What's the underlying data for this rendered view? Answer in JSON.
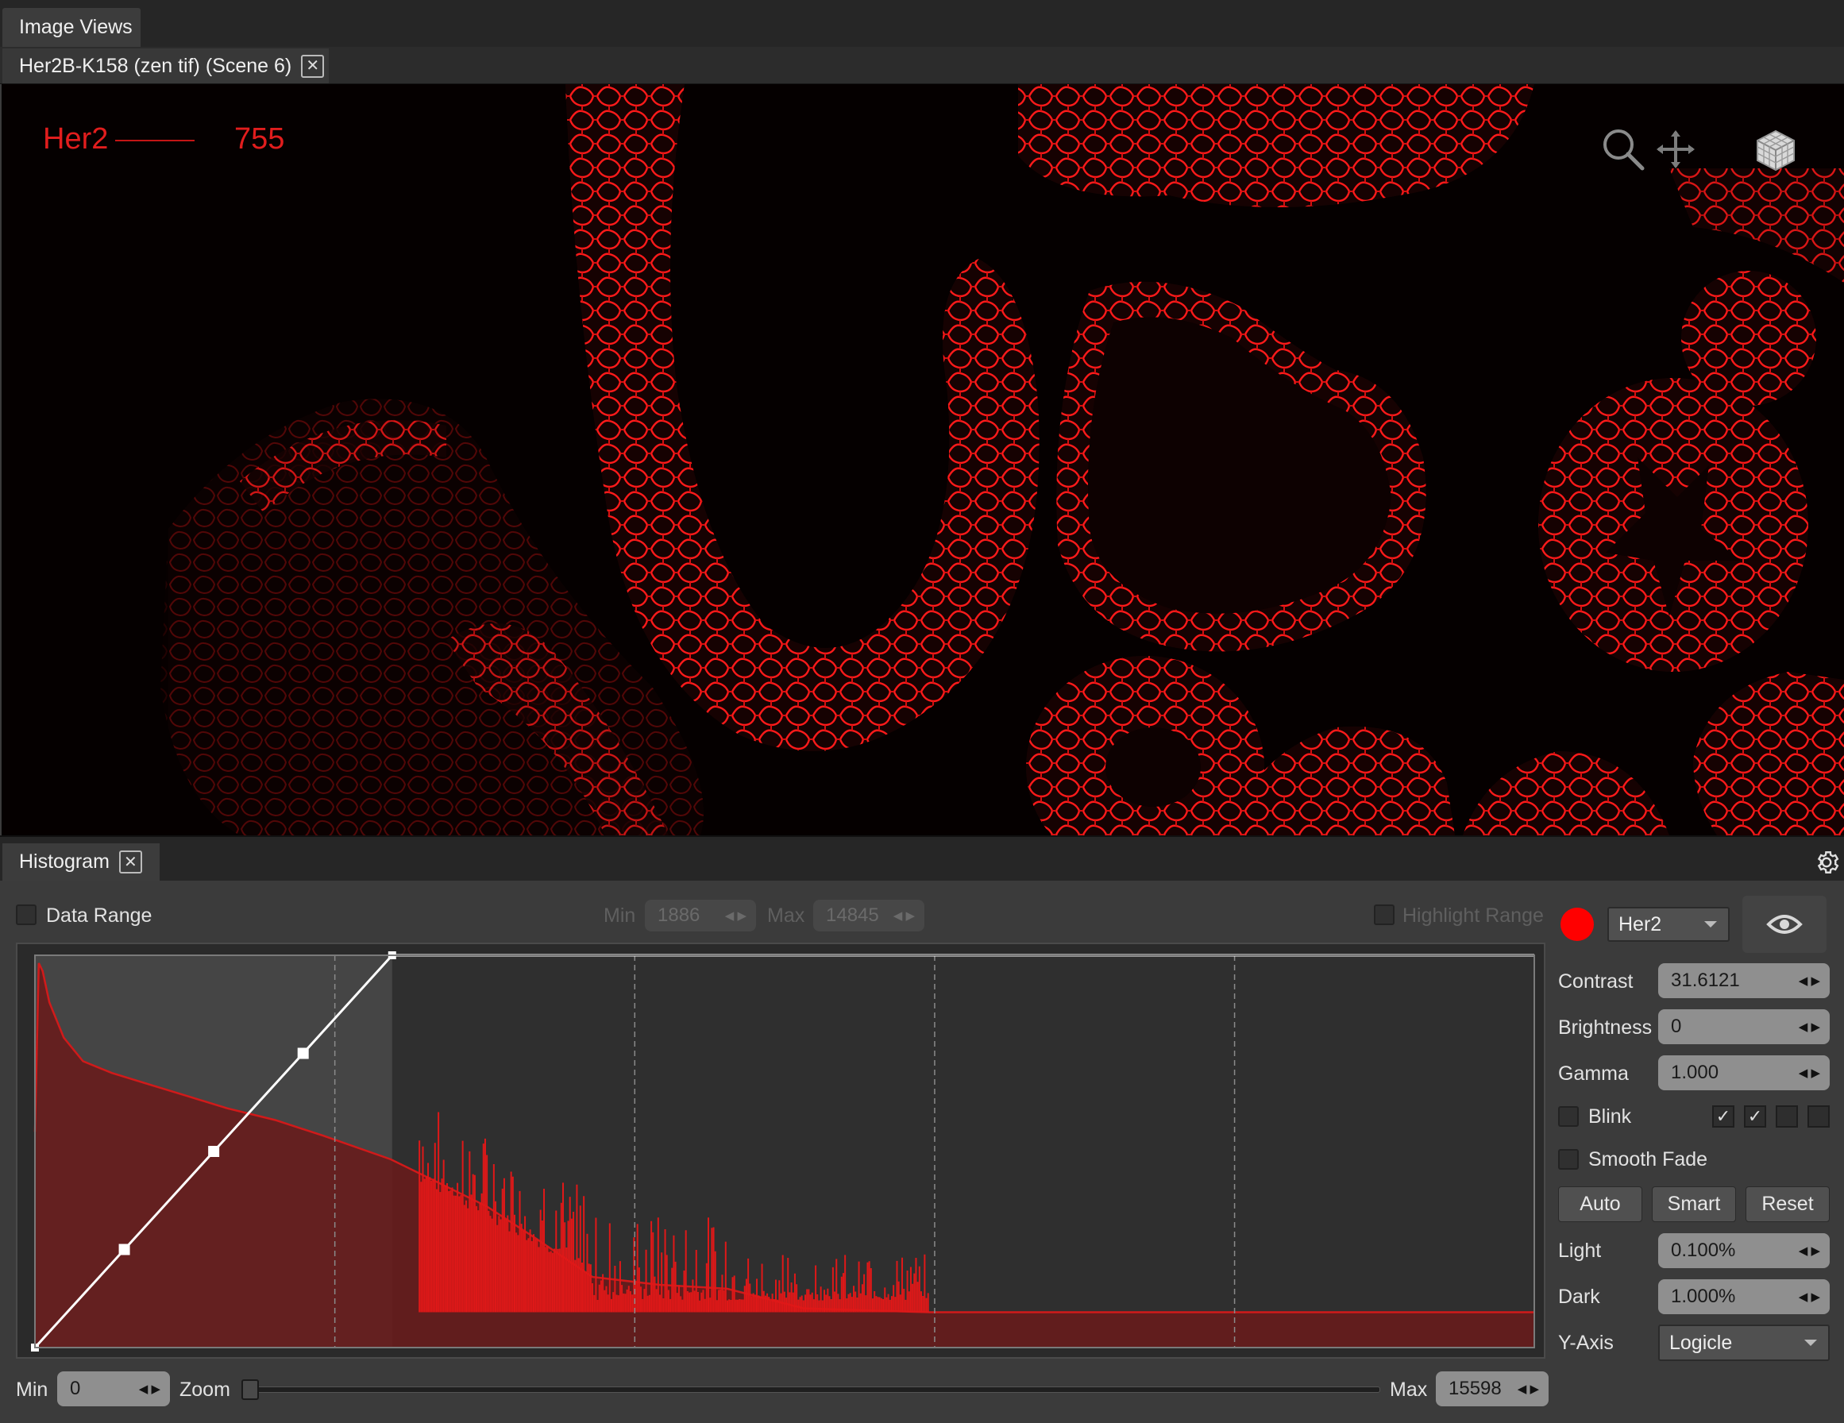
{
  "window": {
    "panel_tab": "Image Views",
    "document_tab": "Her2B-K158 (zen tif) (Scene 6)"
  },
  "viewer": {
    "channel_name": "Her2",
    "channel_value": "755",
    "channel_color": "#e11d1d",
    "tools": [
      "zoom-icon",
      "pan-icon",
      "3d-cube-icon"
    ]
  },
  "histogram": {
    "tab_label": "Histogram",
    "data_range_label": "Data Range",
    "data_range_checked": false,
    "range_min_label": "Min",
    "range_min_value": "1886",
    "range_max_label": "Max",
    "range_max_value": "14845",
    "highlight_range_label": "Highlight Range",
    "bottom_min_label": "Min",
    "bottom_min_value": "0",
    "zoom_label": "Zoom",
    "bottom_max_label": "Max",
    "bottom_max_value": "15598"
  },
  "controls": {
    "channel_color": "#ff0000",
    "channel_select": "Her2",
    "contrast_label": "Contrast",
    "contrast_value": "31.6121",
    "brightness_label": "Brightness",
    "brightness_value": "0",
    "gamma_label": "Gamma",
    "gamma_value": "1.000",
    "blink_label": "Blink",
    "blink_checked": false,
    "blink_channels": [
      true,
      true,
      false,
      false
    ],
    "smooth_fade_label": "Smooth Fade",
    "smooth_fade_checked": false,
    "auto_label": "Auto",
    "smart_label": "Smart",
    "reset_label": "Reset",
    "light_label": "Light",
    "light_value": "0.100%",
    "dark_label": "Dark",
    "dark_value": "1.000%",
    "yaxis_label": "Y-Axis",
    "yaxis_value": "Logicle",
    "check_glyph": "✓"
  },
  "chart_data": {
    "type": "area",
    "title": "",
    "xlabel": "",
    "ylabel": "",
    "xlim": [
      0,
      15598
    ],
    "ylim": [
      0,
      1
    ],
    "yscale": "logicle",
    "grid": "vertical-dashed",
    "x_gridlines": [
      3120,
      6240,
      9360,
      12480
    ],
    "selected_range": [
      0,
      3716
    ],
    "series": [
      {
        "color": "#d11a1a",
        "x": [
          0,
          40,
          80,
          150,
          300,
          500,
          800,
          1200,
          1600,
          2000,
          2500,
          3000,
          3700,
          4200,
          4700,
          5200,
          5800,
          6500,
          7200,
          8000,
          9300,
          12000,
          15598
        ],
        "values": [
          0.55,
          0.98,
          0.96,
          0.88,
          0.79,
          0.73,
          0.7,
          0.67,
          0.64,
          0.61,
          0.58,
          0.54,
          0.48,
          0.42,
          0.36,
          0.28,
          0.18,
          0.16,
          0.15,
          0.1,
          0.09,
          0.09,
          0.09
        ]
      }
    ],
    "transfer_curve": {
      "color": "#ffffff",
      "points": [
        [
          0,
          0
        ],
        [
          930,
          0.25
        ],
        [
          1860,
          0.5
        ],
        [
          2790,
          0.75
        ],
        [
          3716,
          1.0
        ]
      ]
    }
  }
}
